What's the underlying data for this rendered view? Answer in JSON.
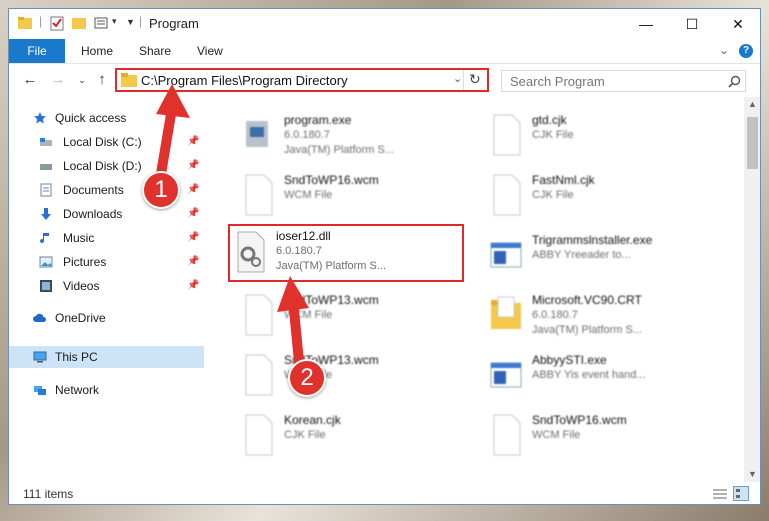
{
  "window": {
    "title": "Program",
    "controls": {
      "minimize": "—",
      "maximize": "☐",
      "close": "✕"
    }
  },
  "ribbon": {
    "tabs": [
      "File",
      "Home",
      "Share",
      "View"
    ],
    "help": "?"
  },
  "address": {
    "path": "C:\\Program Files\\Program Directory",
    "search_placeholder": "Search Program"
  },
  "sidebar": {
    "items": [
      {
        "label": "Quick access",
        "icon": "star-icon",
        "pinned": false
      },
      {
        "label": "Local Disk (C:)",
        "icon": "drive-icon",
        "pinned": true
      },
      {
        "label": "Local Disk (D:)",
        "icon": "drive-icon",
        "pinned": true
      },
      {
        "label": "Documents",
        "icon": "documents-icon",
        "pinned": true
      },
      {
        "label": "Downloads",
        "icon": "download-icon",
        "pinned": true
      },
      {
        "label": "Music",
        "icon": "music-icon",
        "pinned": true
      },
      {
        "label": "Pictures",
        "icon": "pictures-icon",
        "pinned": true
      },
      {
        "label": "Videos",
        "icon": "videos-icon",
        "pinned": true
      },
      {
        "label": "OneDrive",
        "icon": "cloud-icon",
        "pinned": false
      },
      {
        "label": "This PC",
        "icon": "pc-icon",
        "pinned": false,
        "selected": true
      },
      {
        "label": "Network",
        "icon": "network-icon",
        "pinned": false
      }
    ]
  },
  "files": [
    {
      "name": "program.exe",
      "type": "6.0.180.7",
      "desc": "Java(TM) Platform S...",
      "icon": "exe-icon"
    },
    {
      "name": "gtd.cjk",
      "type": "CJK File",
      "desc": "",
      "icon": "file-icon"
    },
    {
      "name": "SndToWP16.wcm",
      "type": "WCM File",
      "desc": "",
      "icon": "file-icon"
    },
    {
      "name": "FastNml.cjk",
      "type": "CJK File",
      "desc": "",
      "icon": "file-icon"
    },
    {
      "name": "Trigrammslnstaller.exe",
      "type": "ABBY Yreeader to...",
      "desc": "",
      "icon": "window-icon"
    },
    {
      "name": "SndToWP13.wcm",
      "type": "WCM File",
      "desc": "",
      "icon": "file-icon"
    },
    {
      "name": "Microsoft.VC90.CRT",
      "type": "6.0.180.7",
      "desc": "Java(TM) Platform S...",
      "icon": "folder-icon"
    },
    {
      "name": "SndToWP13.wcm",
      "type": "WCM File",
      "desc": "",
      "icon": "file-icon"
    },
    {
      "name": "AbbyySTI.exe",
      "type": "ABBY Yis event hand...",
      "desc": "",
      "icon": "window-icon"
    },
    {
      "name": "Korean.cjk",
      "type": "CJK File",
      "desc": "",
      "icon": "file-icon"
    },
    {
      "name": "SndToWP16.wcm",
      "type": "WCM File",
      "desc": "",
      "icon": "file-icon"
    }
  ],
  "highlighted_file": {
    "name": "ioser12.dll",
    "type": "6.0.180.7",
    "desc": "Java(TM) Platform S..."
  },
  "status": {
    "count": "111 items"
  },
  "callouts": {
    "one": "1",
    "two": "2"
  },
  "colors": {
    "accent": "#1979ca",
    "highlight": "#e02a2a",
    "selected": "#cde4f7"
  }
}
